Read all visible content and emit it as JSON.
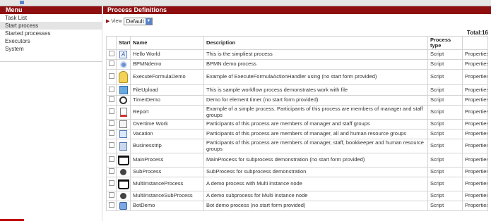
{
  "sidebar": {
    "header": "Menu",
    "items": [
      {
        "label": "Task List",
        "active": false
      },
      {
        "label": "Start process",
        "active": true
      },
      {
        "label": "Started processes",
        "active": false
      },
      {
        "label": "Executors",
        "active": false
      },
      {
        "label": "System",
        "active": false
      }
    ]
  },
  "main": {
    "header": "Process Definitions",
    "view_label": "View",
    "view_value": "Default",
    "total": "Total:16",
    "columns": [
      "Start",
      "Name",
      "Description",
      "Process type"
    ],
    "rows": [
      {
        "icon": "hello-world-icon",
        "name": "Hello World",
        "description": "This is the simpliest process",
        "type": "Script",
        "action": "Properties"
      },
      {
        "icon": "bpmn-icon",
        "name": "BPMNdemo",
        "description": "BPMN demo process",
        "type": "Script",
        "action": "Properties"
      },
      {
        "icon": "key-icon",
        "name": "ExecuteFormulaDemo",
        "description": "Example of ExecuteFormulaActionHandler using (no start form provided)",
        "type": "Script",
        "action": "Properties"
      },
      {
        "icon": "upload-icon",
        "name": "FileUpload",
        "description": "This is sample workflow process demonstrates work with file",
        "type": "Script",
        "action": "Properties"
      },
      {
        "icon": "timer-icon",
        "name": "TimerDemo",
        "description": "Demo for element timer (no start form provided)",
        "type": "Script",
        "action": "Properties"
      },
      {
        "icon": "report-icon",
        "name": "Report",
        "description": "Example of a simple process. Participants of this process are members of manager and staff groups",
        "type": "Script",
        "action": "Properties"
      },
      {
        "icon": "overtime-icon",
        "name": "Overtime Work",
        "description": "Participants of this process are members of manager and staff groups",
        "type": "Script",
        "action": "Properties"
      },
      {
        "icon": "vacation-icon",
        "name": "Vacation",
        "description": "Participants of this process are members of manager, all and human resource groups",
        "type": "Script",
        "action": "Properties"
      },
      {
        "icon": "business-trip-icon",
        "name": "Businesstrip",
        "description": "Participants of this process are members of manager, staff, bookkeeper and human resource groups",
        "type": "Script",
        "action": "Properties"
      },
      {
        "icon": "cart-icon",
        "name": "MainProcess",
        "description": "MainProcess for subprocess demonstration (no start form provided)",
        "type": "Script",
        "action": "Properties"
      },
      {
        "icon": "play-icon",
        "name": "SubProcess",
        "description": "SubProcess for subprocess demonstration",
        "type": "Script",
        "action": "Properties"
      },
      {
        "icon": "cart-icon",
        "name": "MultiInstanceProcess",
        "description": "A demo process with Multi instance node",
        "type": "Script",
        "action": "Properties"
      },
      {
        "icon": "play-icon",
        "name": "MultiInstanceSubProcess",
        "description": "A demo subprocess for Multi instance node",
        "type": "Script",
        "action": "Properties"
      },
      {
        "icon": "bot-icon",
        "name": "BotDemo",
        "description": "Bot demo process (no start form provided)",
        "type": "Script",
        "action": "Properties"
      }
    ]
  },
  "colors": {
    "header_bg": "#8f0f11",
    "active_item_bg": "#e4e4e4"
  }
}
